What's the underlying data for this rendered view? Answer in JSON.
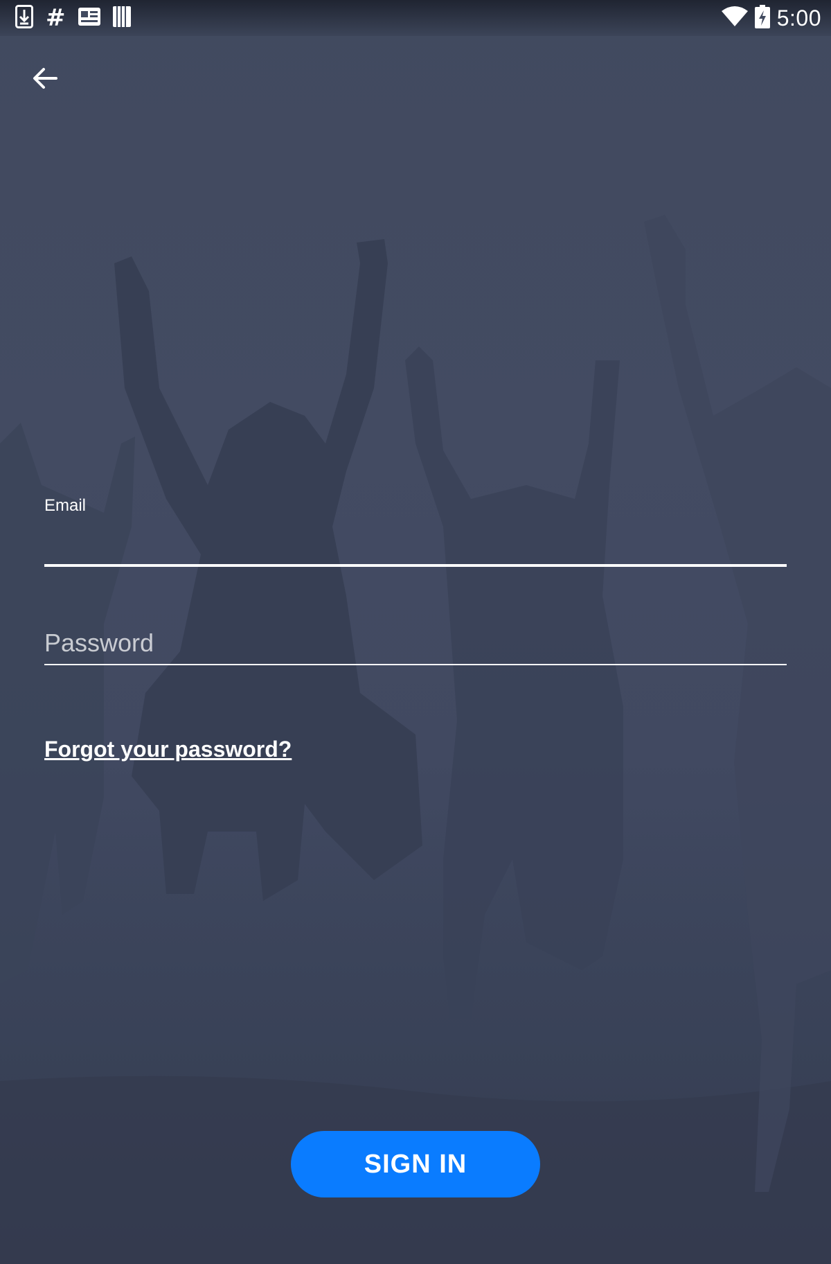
{
  "status_bar": {
    "time": "5:00",
    "left_icons": [
      "download-icon",
      "hash-icon",
      "news-icon",
      "barcode-icon"
    ],
    "right_icons": [
      "wifi-icon",
      "battery-charging-icon"
    ],
    "hash_glyph": "#"
  },
  "header": {
    "back_icon": "arrow-back-icon"
  },
  "form": {
    "email": {
      "label": "Email",
      "value": "",
      "placeholder": ""
    },
    "password": {
      "value": "",
      "placeholder": "Password"
    },
    "forgot_password_label": "Forgot your password?",
    "sign_in_label": "SIGN IN"
  },
  "colors": {
    "overlay": "#424a61",
    "accent_button": "#0a7cff",
    "text": "#ffffff"
  }
}
